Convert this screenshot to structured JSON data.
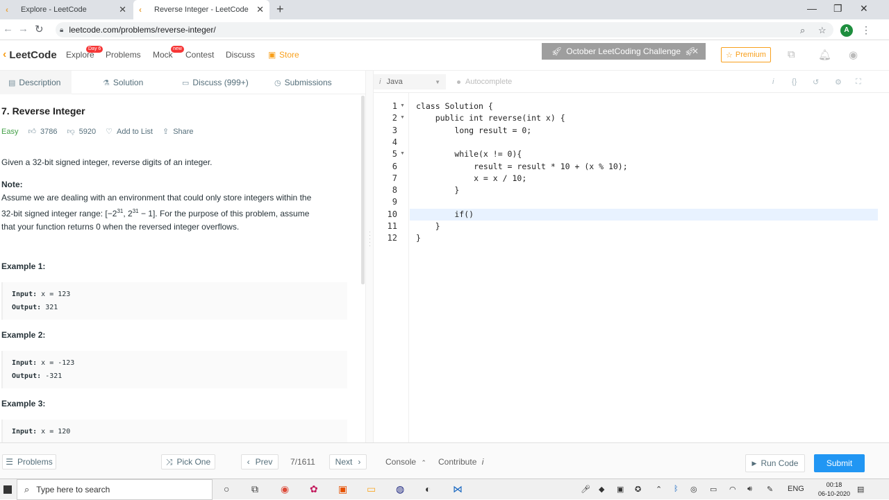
{
  "browser": {
    "tabs": [
      {
        "title": "Explore - LeetCode"
      },
      {
        "title": "Reverse Integer - LeetCode"
      }
    ],
    "url": "leetcode.com/problems/reverse-integer/",
    "profile_initial": "A"
  },
  "nav": {
    "brand": "LeetCode",
    "links": {
      "explore": "Explore",
      "explore_badge": "Day 6",
      "problems": "Problems",
      "mock": "Mock",
      "mock_badge": "new",
      "contest": "Contest",
      "discuss": "Discuss",
      "store": "Store"
    },
    "challenge": "October LeetCoding Challenge",
    "premium": "Premium"
  },
  "left_tabs": {
    "description": "Description",
    "solution": "Solution",
    "discuss": "Discuss (999+)",
    "submissions": "Submissions"
  },
  "problem": {
    "title": "7. Reverse Integer",
    "difficulty": "Easy",
    "likes": "3786",
    "dislikes": "5920",
    "add_to_list": "Add to List",
    "share": "Share",
    "summary": "Given a 32-bit signed integer, reverse digits of an integer.",
    "note_label": "Note:",
    "note_line1": "Assume we are dealing with an environment that could only store integers within the",
    "note_line2_a": "32-bit signed integer range: [−2",
    "note_exp": "31",
    "note_line2_b": ",  2",
    "note_line2_c": " − 1]. For the purpose of this problem, assume",
    "note_line3": "that your function returns 0 when the reversed integer overflows."
  },
  "examples": [
    {
      "label": "Example 1:",
      "input_label": "Input:",
      "input": "x = 123",
      "output_label": "Output:",
      "output": "321"
    },
    {
      "label": "Example 2:",
      "input_label": "Input:",
      "input": "x = -123",
      "output_label": "Output:",
      "output": "-321"
    },
    {
      "label": "Example 3:",
      "input_label": "Input:",
      "input": "x = 120",
      "output_label": "",
      "output": ""
    }
  ],
  "editor": {
    "language": "Java",
    "autocomplete": "Autocomplete",
    "lines": [
      {
        "num": "1",
        "code": "class Solution {"
      },
      {
        "num": "2",
        "code": "    public int reverse(int x) {"
      },
      {
        "num": "3",
        "code": "        long result = 0;"
      },
      {
        "num": "4",
        "code": ""
      },
      {
        "num": "5",
        "code": "        while(x != 0){"
      },
      {
        "num": "6",
        "code": "            result = result * 10 + (x % 10);"
      },
      {
        "num": "7",
        "code": "            x = x / 10;"
      },
      {
        "num": "8",
        "code": "        }"
      },
      {
        "num": "9",
        "code": ""
      },
      {
        "num": "10",
        "code": "        if()"
      },
      {
        "num": "11",
        "code": "    }"
      },
      {
        "num": "12",
        "code": "}"
      }
    ],
    "active_line": 10
  },
  "bottom": {
    "problems": "Problems",
    "pick_one": "Pick One",
    "prev": "Prev",
    "page": "7/1611",
    "next": "Next",
    "console": "Console",
    "contribute": "Contribute",
    "run_code": "Run Code",
    "submit": "Submit"
  },
  "taskbar": {
    "search_placeholder": "Type here to search",
    "lang": "ENG",
    "time": "00:18",
    "date": "06-10-2020"
  },
  "colors": {
    "brand": "#f89f1b",
    "submit": "#2196f3",
    "easy": "#43a047",
    "challenge_bg": "#9e9e9e"
  }
}
